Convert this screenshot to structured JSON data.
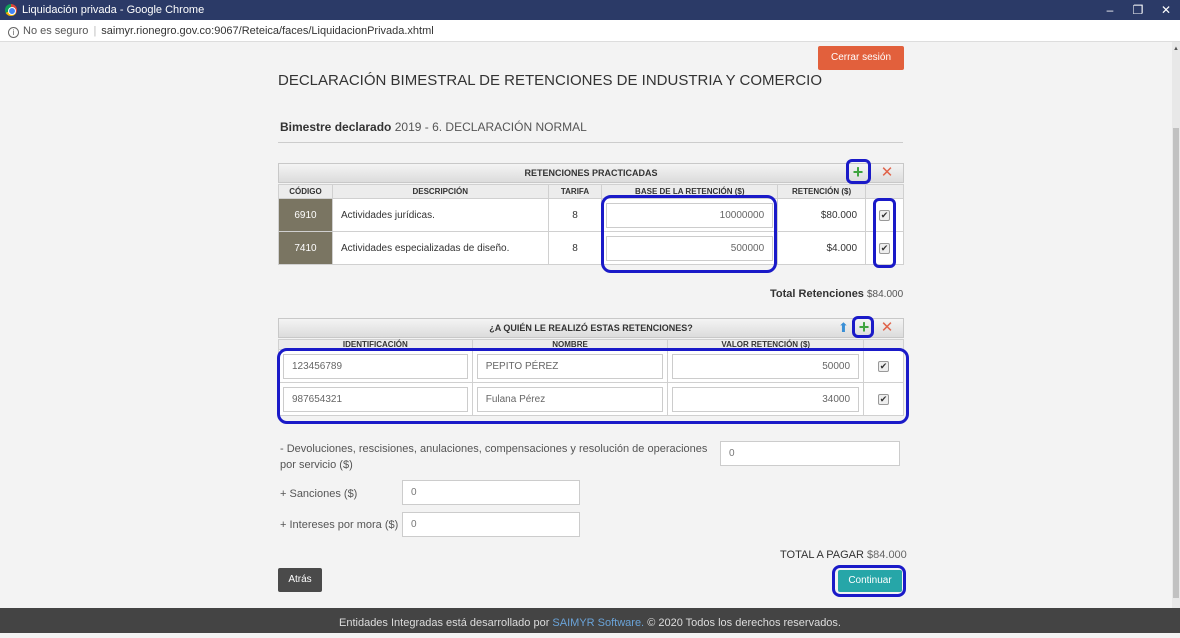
{
  "browser": {
    "window_title": "Liquidación privada - Google Chrome",
    "security_label": "No es seguro",
    "url": "saimyr.rionegro.gov.co:9067/Reteica/faces/LiquidacionPrivada.xhtml"
  },
  "header": {
    "logout_label": "Cerrar sesión",
    "title": "DECLARACIÓN BIMESTRAL DE RETENCIONES DE INDUSTRIA Y COMERCIO",
    "period_label": "Bimestre declarado",
    "period_value": "2019 - 6. DECLARACIÓN NORMAL"
  },
  "retenciones": {
    "panel_title": "RETENCIONES PRACTICADAS",
    "columns": [
      "CÓDIGO",
      "DESCRIPCIÓN",
      "TARIFA",
      "BASE DE LA RETENCIÓN ($)",
      "RETENCIÓN ($)"
    ],
    "rows": [
      {
        "codigo": "6910",
        "descripcion": "Actividades jurídicas.",
        "tarifa": "8",
        "base": "10000000",
        "retencion": "$80.000",
        "checked": "✔"
      },
      {
        "codigo": "7410",
        "descripcion": "Actividades especializadas de diseño.",
        "tarifa": "8",
        "base": "500000",
        "retencion": "$4.000",
        "checked": "✔"
      }
    ],
    "total_label": "Total Retenciones",
    "total_value": "$84.000"
  },
  "agentes": {
    "panel_title": "¿A QUIÉN LE REALIZÓ ESTAS RETENCIONES?",
    "columns": [
      "IDENTIFICACIÓN",
      "NOMBRE",
      "VALOR RETENCIÓN ($)"
    ],
    "rows": [
      {
        "identificacion": "123456789",
        "nombre": "PEPITO PÉREZ",
        "valor": "50000",
        "checked": "✔"
      },
      {
        "identificacion": "987654321",
        "nombre": "Fulana Pérez",
        "valor": "34000",
        "checked": "✔"
      }
    ]
  },
  "ajustes": {
    "devoluciones_label": "- Devoluciones, rescisiones, anulaciones, compensaciones y resolución de operaciones por servicio ($)",
    "devoluciones_value": "0",
    "sanciones_label": "+ Sanciones ($)",
    "sanciones_value": "0",
    "intereses_label": "+ Intereses por mora ($)",
    "intereses_value": "0"
  },
  "summary": {
    "total_label": "TOTAL A PAGAR",
    "total_value": "$84.000"
  },
  "actions": {
    "back_label": "Atrás",
    "continue_label": "Continuar"
  },
  "footer": {
    "prefix": "Entidades Integradas está desarrollado por",
    "link": "SAIMYR Software.",
    "suffix": "© 2020 Todos los derechos reservados."
  },
  "icons": {
    "add": "plus-icon",
    "remove": "close-icon",
    "upload": "arrow-up-icon"
  },
  "colors": {
    "logout": "#e2603c",
    "continue": "#26a6a8",
    "code_cell": "#7a7562",
    "highlight": "#1a1ac8",
    "add_icon": "#3ea33e",
    "remove_icon": "#e0634a"
  }
}
